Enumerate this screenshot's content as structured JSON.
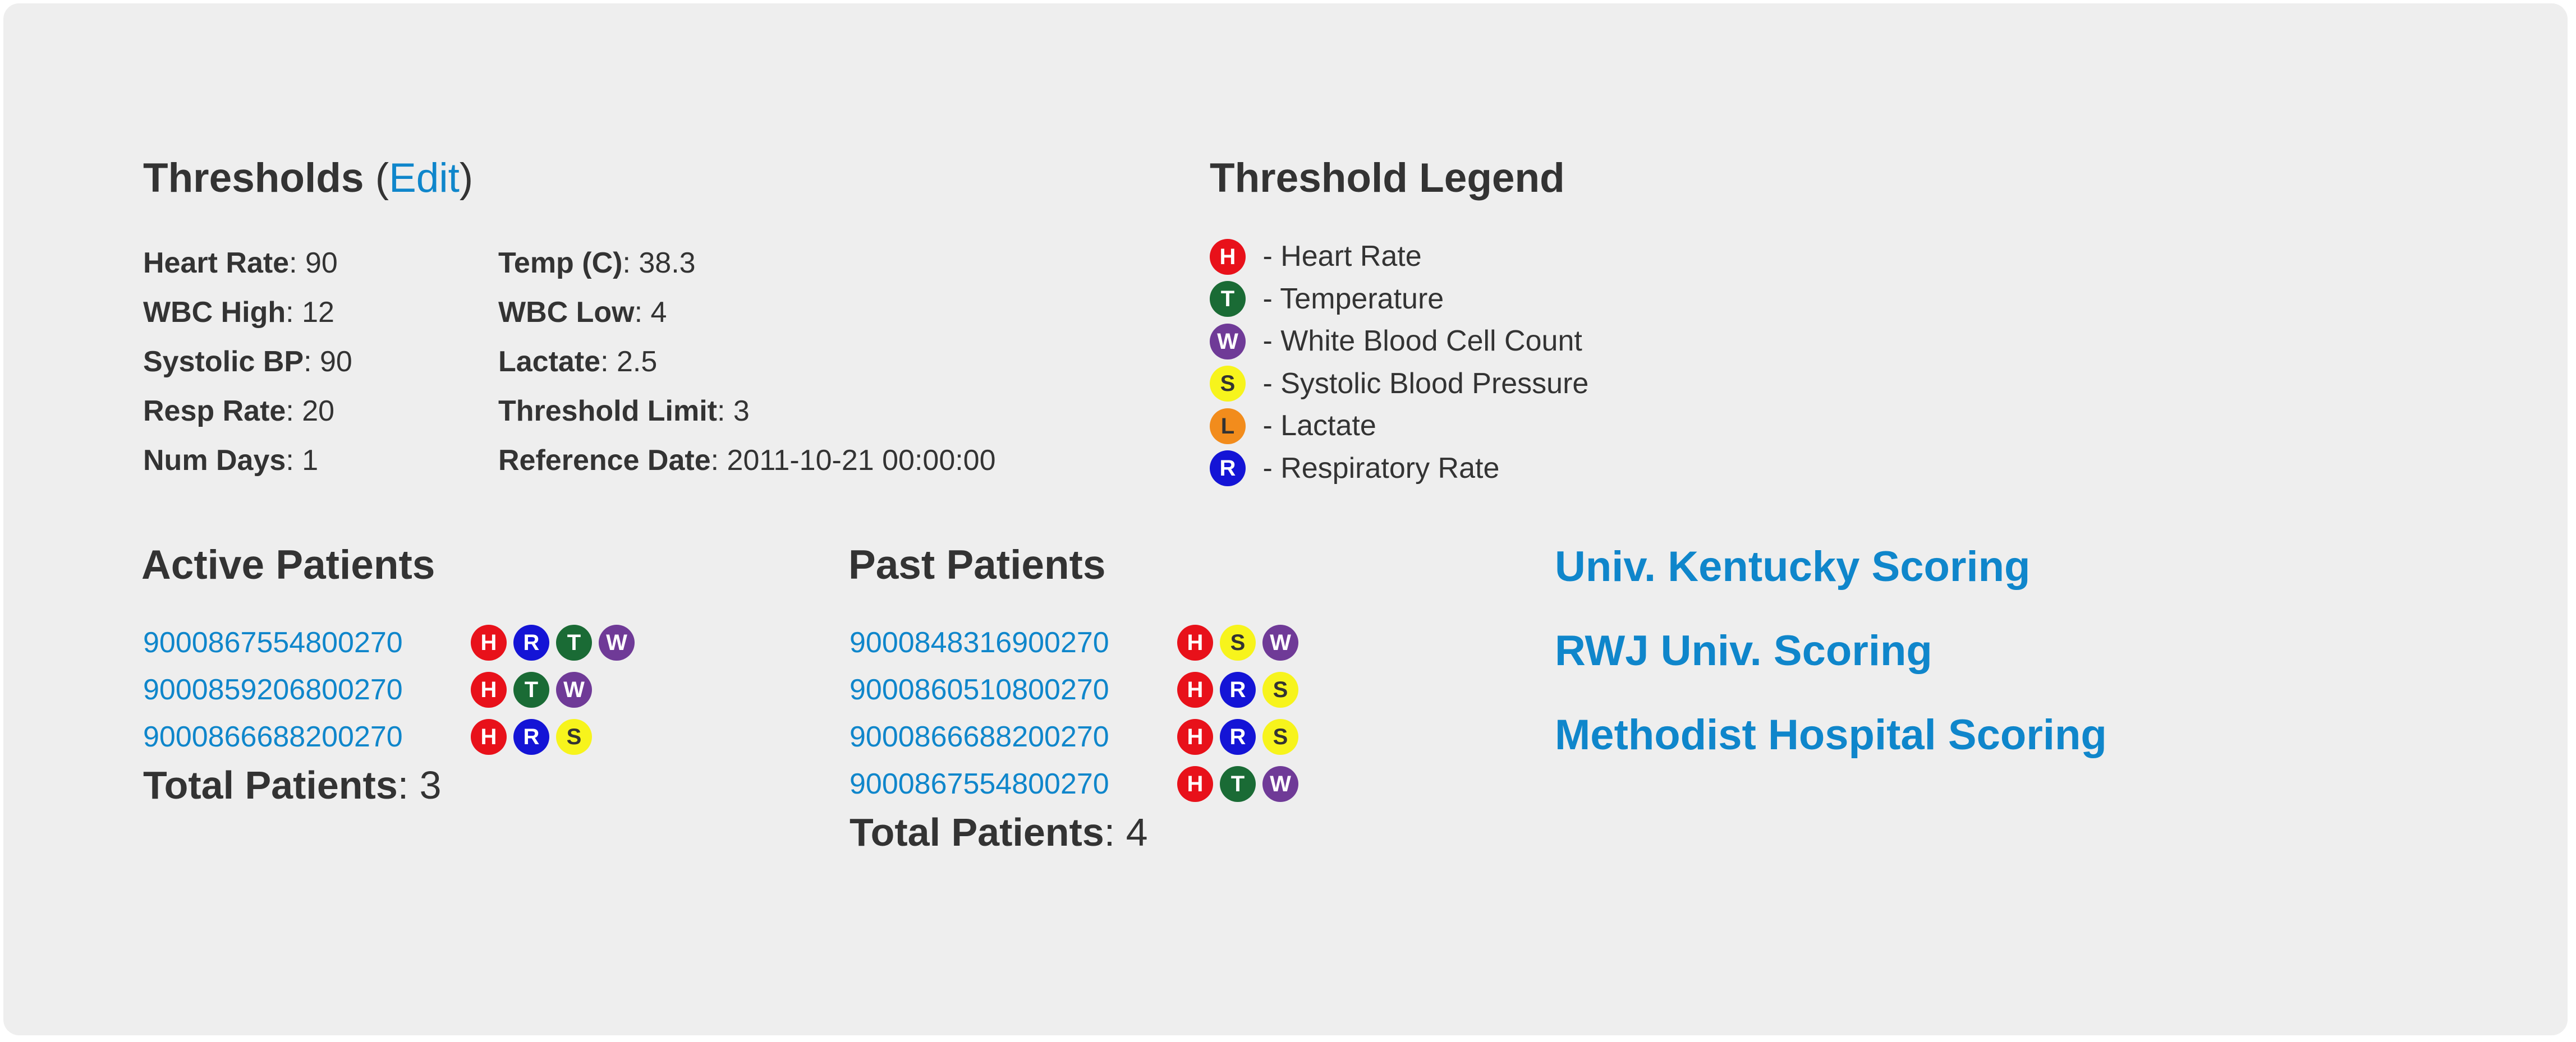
{
  "badge_types": {
    "H": {
      "letter": "H",
      "bg": "#e8111a",
      "fg": "#ffffff",
      "meaning": "Heart Rate"
    },
    "T": {
      "letter": "T",
      "bg": "#1a6b35",
      "fg": "#ffffff",
      "meaning": "Temperature"
    },
    "W": {
      "letter": "W",
      "bg": "#6f3a97",
      "fg": "#ffffff",
      "meaning": "White Blood Cell Count"
    },
    "S": {
      "letter": "S",
      "bg": "#f7f41c",
      "fg": "#333333",
      "meaning": "Systolic Blood Pressure"
    },
    "L": {
      "letter": "L",
      "bg": "#f28c1c",
      "fg": "#333333",
      "meaning": "Lactate"
    },
    "R": {
      "letter": "R",
      "bg": "#1414d6",
      "fg": "#ffffff",
      "meaning": "Respiratory Rate"
    }
  },
  "thresholds": {
    "title": "Thresholds",
    "open_paren": "(",
    "edit_label": "Edit",
    "close_paren": ")",
    "left": [
      {
        "label": "Heart Rate",
        "value": "90"
      },
      {
        "label": "WBC High",
        "value": "12"
      },
      {
        "label": "Systolic BP",
        "value": "90"
      },
      {
        "label": "Resp Rate",
        "value": "20"
      },
      {
        "label": "Num Days",
        "value": "1"
      }
    ],
    "right": [
      {
        "label": "Temp (C)",
        "value": "38.3"
      },
      {
        "label": "WBC Low",
        "value": "4"
      },
      {
        "label": "Lactate",
        "value": "2.5"
      },
      {
        "label": "Threshold Limit",
        "value": "3"
      },
      {
        "label": "Reference Date",
        "value": "2011-10-21 00:00:00"
      }
    ],
    "separator": ": "
  },
  "legend": {
    "title": "Threshold Legend",
    "items": [
      {
        "badge": "H",
        "text": " - Heart Rate"
      },
      {
        "badge": "T",
        "text": " - Temperature"
      },
      {
        "badge": "W",
        "text": " - White Blood Cell Count"
      },
      {
        "badge": "S",
        "text": " - Systolic Blood Pressure"
      },
      {
        "badge": "L",
        "text": " - Lactate"
      },
      {
        "badge": "R",
        "text": " - Respiratory Rate"
      }
    ]
  },
  "active_patients": {
    "title": "Active Patients",
    "patients": [
      {
        "id": "9000867554800270",
        "badges": [
          "H",
          "R",
          "T",
          "W"
        ]
      },
      {
        "id": "9000859206800270",
        "badges": [
          "H",
          "T",
          "W"
        ]
      },
      {
        "id": "9000866688200270",
        "badges": [
          "H",
          "R",
          "S"
        ]
      }
    ],
    "total_label": "Total Patients",
    "total_value": ": 3"
  },
  "past_patients": {
    "title": "Past Patients",
    "patients": [
      {
        "id": "9000848316900270",
        "badges": [
          "H",
          "S",
          "W"
        ]
      },
      {
        "id": "9000860510800270",
        "badges": [
          "H",
          "R",
          "S"
        ]
      },
      {
        "id": "9000866688200270",
        "badges": [
          "H",
          "R",
          "S"
        ]
      },
      {
        "id": "9000867554800270",
        "badges": [
          "H",
          "T",
          "W"
        ]
      }
    ],
    "total_label": "Total Patients",
    "total_value": ": 4"
  },
  "scoring_links": [
    "Univ. Kentucky Scoring",
    "RWJ Univ. Scoring",
    "Methodist Hospital Scoring"
  ]
}
